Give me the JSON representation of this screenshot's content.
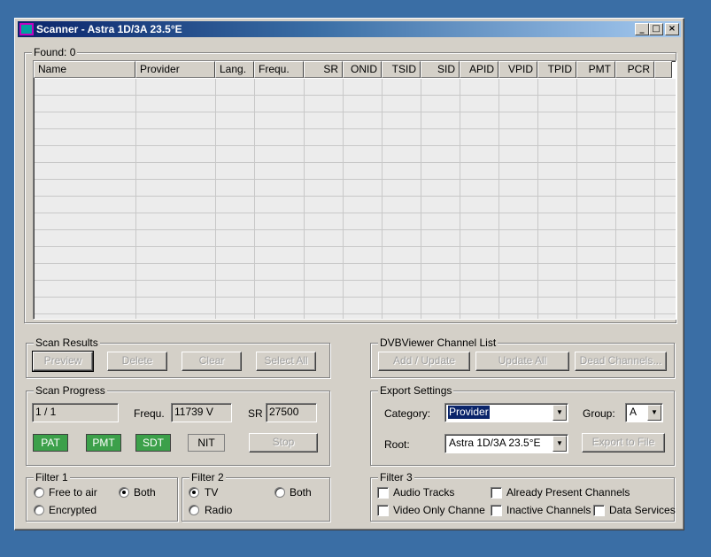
{
  "window": {
    "title": "Scanner - Astra 1D/3A 23.5°E",
    "minimize": "_",
    "maximize": "□",
    "close": "×"
  },
  "found": {
    "label": "Found:",
    "count": "0"
  },
  "list": {
    "columns": [
      "Name",
      "Provider",
      "Lang.",
      "Frequ.",
      "SR",
      "ONID",
      "TSID",
      "SID",
      "APID",
      "VPID",
      "TPID",
      "PMT",
      "PCR"
    ]
  },
  "scan_results": {
    "title": "Scan Results",
    "preview": "Preview",
    "delete": "Delete",
    "clear": "Clear",
    "select_all": "Select All"
  },
  "channel_list": {
    "title": "DVBViewer Channel List",
    "add_update": "Add / Update",
    "update_all": "Update All",
    "dead_channels": "Dead Channels..."
  },
  "scan_progress": {
    "title": "Scan Progress",
    "progress_value": "1 / 1",
    "frequ_label": "Frequ.",
    "frequ_value": "11739 V",
    "sr_label": "SR",
    "sr_value": "27500",
    "pat": "PAT",
    "pmt": "PMT",
    "sdt": "SDT",
    "nit": "NIT",
    "stop": "Stop"
  },
  "export_settings": {
    "title": "Export Settings",
    "category_label": "Category:",
    "category_value": "Provider",
    "group_label": "Group:",
    "group_value": "A",
    "root_label": "Root:",
    "root_value": "Astra 1D/3A 23.5°E",
    "export_button": "Export to File"
  },
  "filter1": {
    "title": "Filter 1",
    "free_to_air": "Free to air",
    "both": "Both",
    "encrypted": "Encrypted",
    "selected": "Both"
  },
  "filter2": {
    "title": "Filter 2",
    "tv": "TV",
    "both": "Both",
    "radio": "Radio",
    "selected": "TV"
  },
  "filter3": {
    "title": "Filter 3",
    "audio_tracks": "Audio Tracks",
    "already_present": "Already Present Channels",
    "video_only": "Video Only Channe",
    "inactive": "Inactive Channels",
    "data_services": "Data Services"
  },
  "colors": {
    "desktop": "#3a6ea5",
    "indicator_on": "#3ca04a",
    "selection": "#0a246a"
  }
}
